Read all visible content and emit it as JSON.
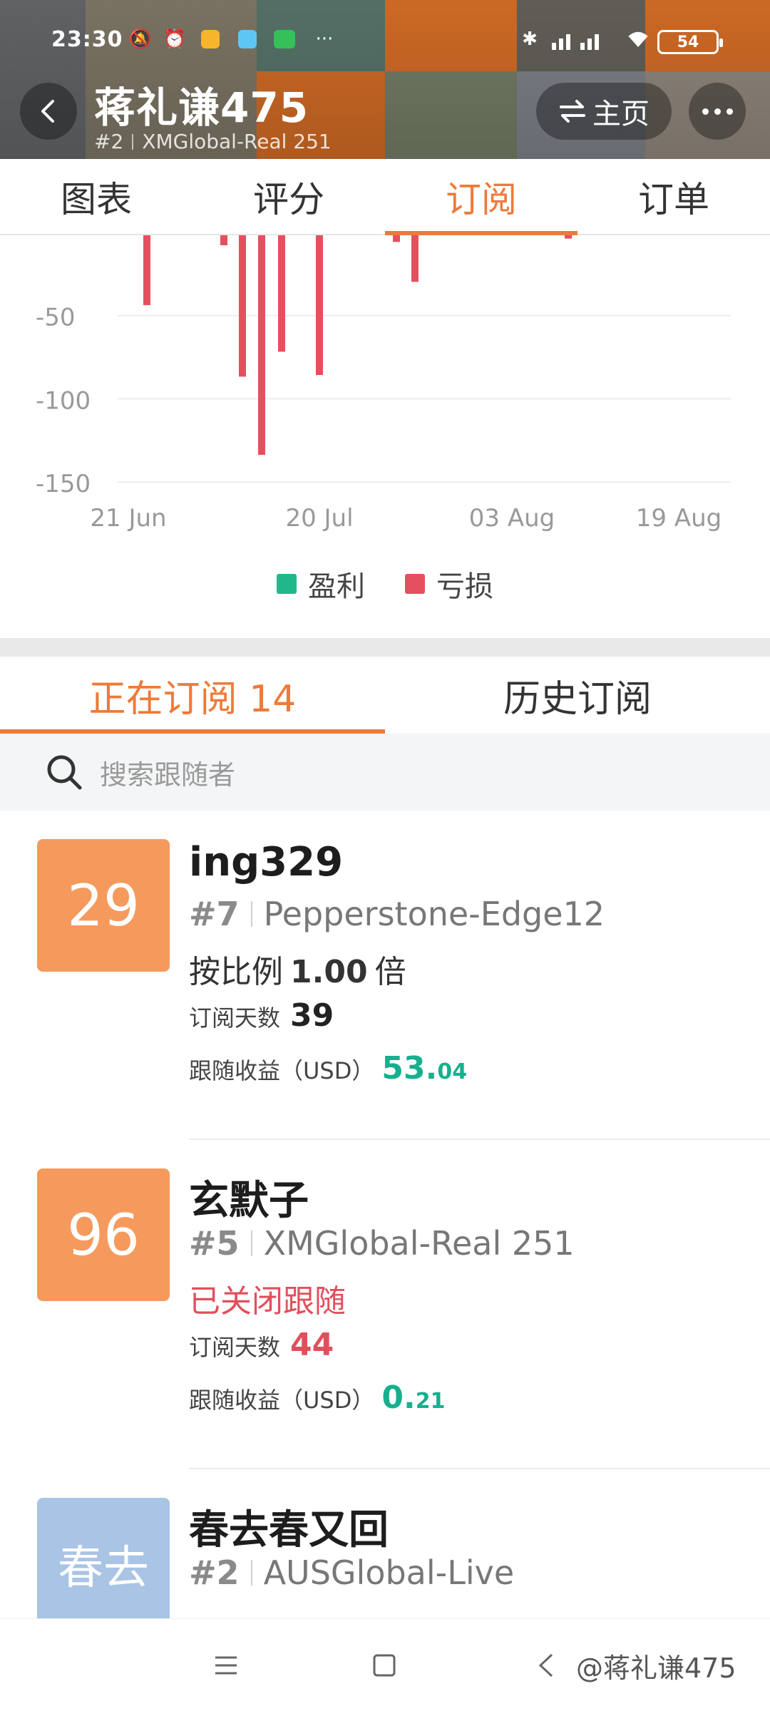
{
  "status_bar": {
    "time": "23:30",
    "battery": "54",
    "icons": [
      "mute-icon",
      "alarm-icon",
      "app-icon",
      "play-icon",
      "iqiyi-icon",
      "bluetooth-icon",
      "signal-icon",
      "wifi-icon",
      "battery-icon"
    ]
  },
  "header": {
    "name": "蒋礼谦475",
    "rank": "#2",
    "server": "XMGlobal-Real 251",
    "home_label": "主页",
    "back_icon": "back-arrow-icon",
    "more_icon": "more-dots-icon"
  },
  "tabs": [
    {
      "label": "图表",
      "active": false
    },
    {
      "label": "评分",
      "active": false
    },
    {
      "label": "订阅",
      "active": true
    },
    {
      "label": "订单",
      "active": false
    }
  ],
  "chart_data": {
    "type": "bar",
    "y_ticks": [
      "-50",
      "-100",
      "-150"
    ],
    "x_ticks": [
      "21 Jun",
      "20 Jul",
      "03 Aug",
      "19 Aug"
    ],
    "ylim": [
      -150,
      0
    ],
    "series": [
      {
        "name": "盈利",
        "color": "#1fb88a",
        "values": []
      },
      {
        "name": "亏损",
        "color": "#e5505e",
        "values": [
          -42,
          -6,
          -85,
          -132,
          -70,
          -84,
          -4,
          -28,
          -2
        ]
      }
    ]
  },
  "subtabs": [
    {
      "label": "正在订阅 14",
      "active": true
    },
    {
      "label": "历史订阅",
      "active": false
    }
  ],
  "search": {
    "placeholder": "搜索跟随者"
  },
  "followers": [
    {
      "avatar_text": "29",
      "avatar_color": "#f59a5c",
      "name": "ing329",
      "rank": "#7",
      "broker": "Pepperstone-Edge12",
      "ratio_prefix": "按比例",
      "ratio_value": "1.00",
      "ratio_suffix": "倍",
      "days_label": "订阅天数",
      "days": "39",
      "profit_label": "跟随收益（USD）",
      "profit_int": "53.",
      "profit_dec": "04"
    },
    {
      "avatar_text": "96",
      "avatar_color": "#f59a5c",
      "name": "玄默子",
      "rank": "#5",
      "broker": "XMGlobal-Real 251",
      "status": "已关闭跟随",
      "days_label": "订阅天数",
      "days": "44",
      "profit_label": "跟随收益（USD）",
      "profit_int": "0.",
      "profit_dec": "21"
    },
    {
      "avatar_text": "春去",
      "avatar_color": "#a9c4e4",
      "name": "春去春又回",
      "rank": "#2",
      "broker": "AUSGlobal-Live"
    }
  ],
  "navbar": {
    "icons": [
      "menu-icon",
      "home-square-icon",
      "back-triangle-icon"
    ],
    "watermark": "@蒋礼谦475"
  }
}
